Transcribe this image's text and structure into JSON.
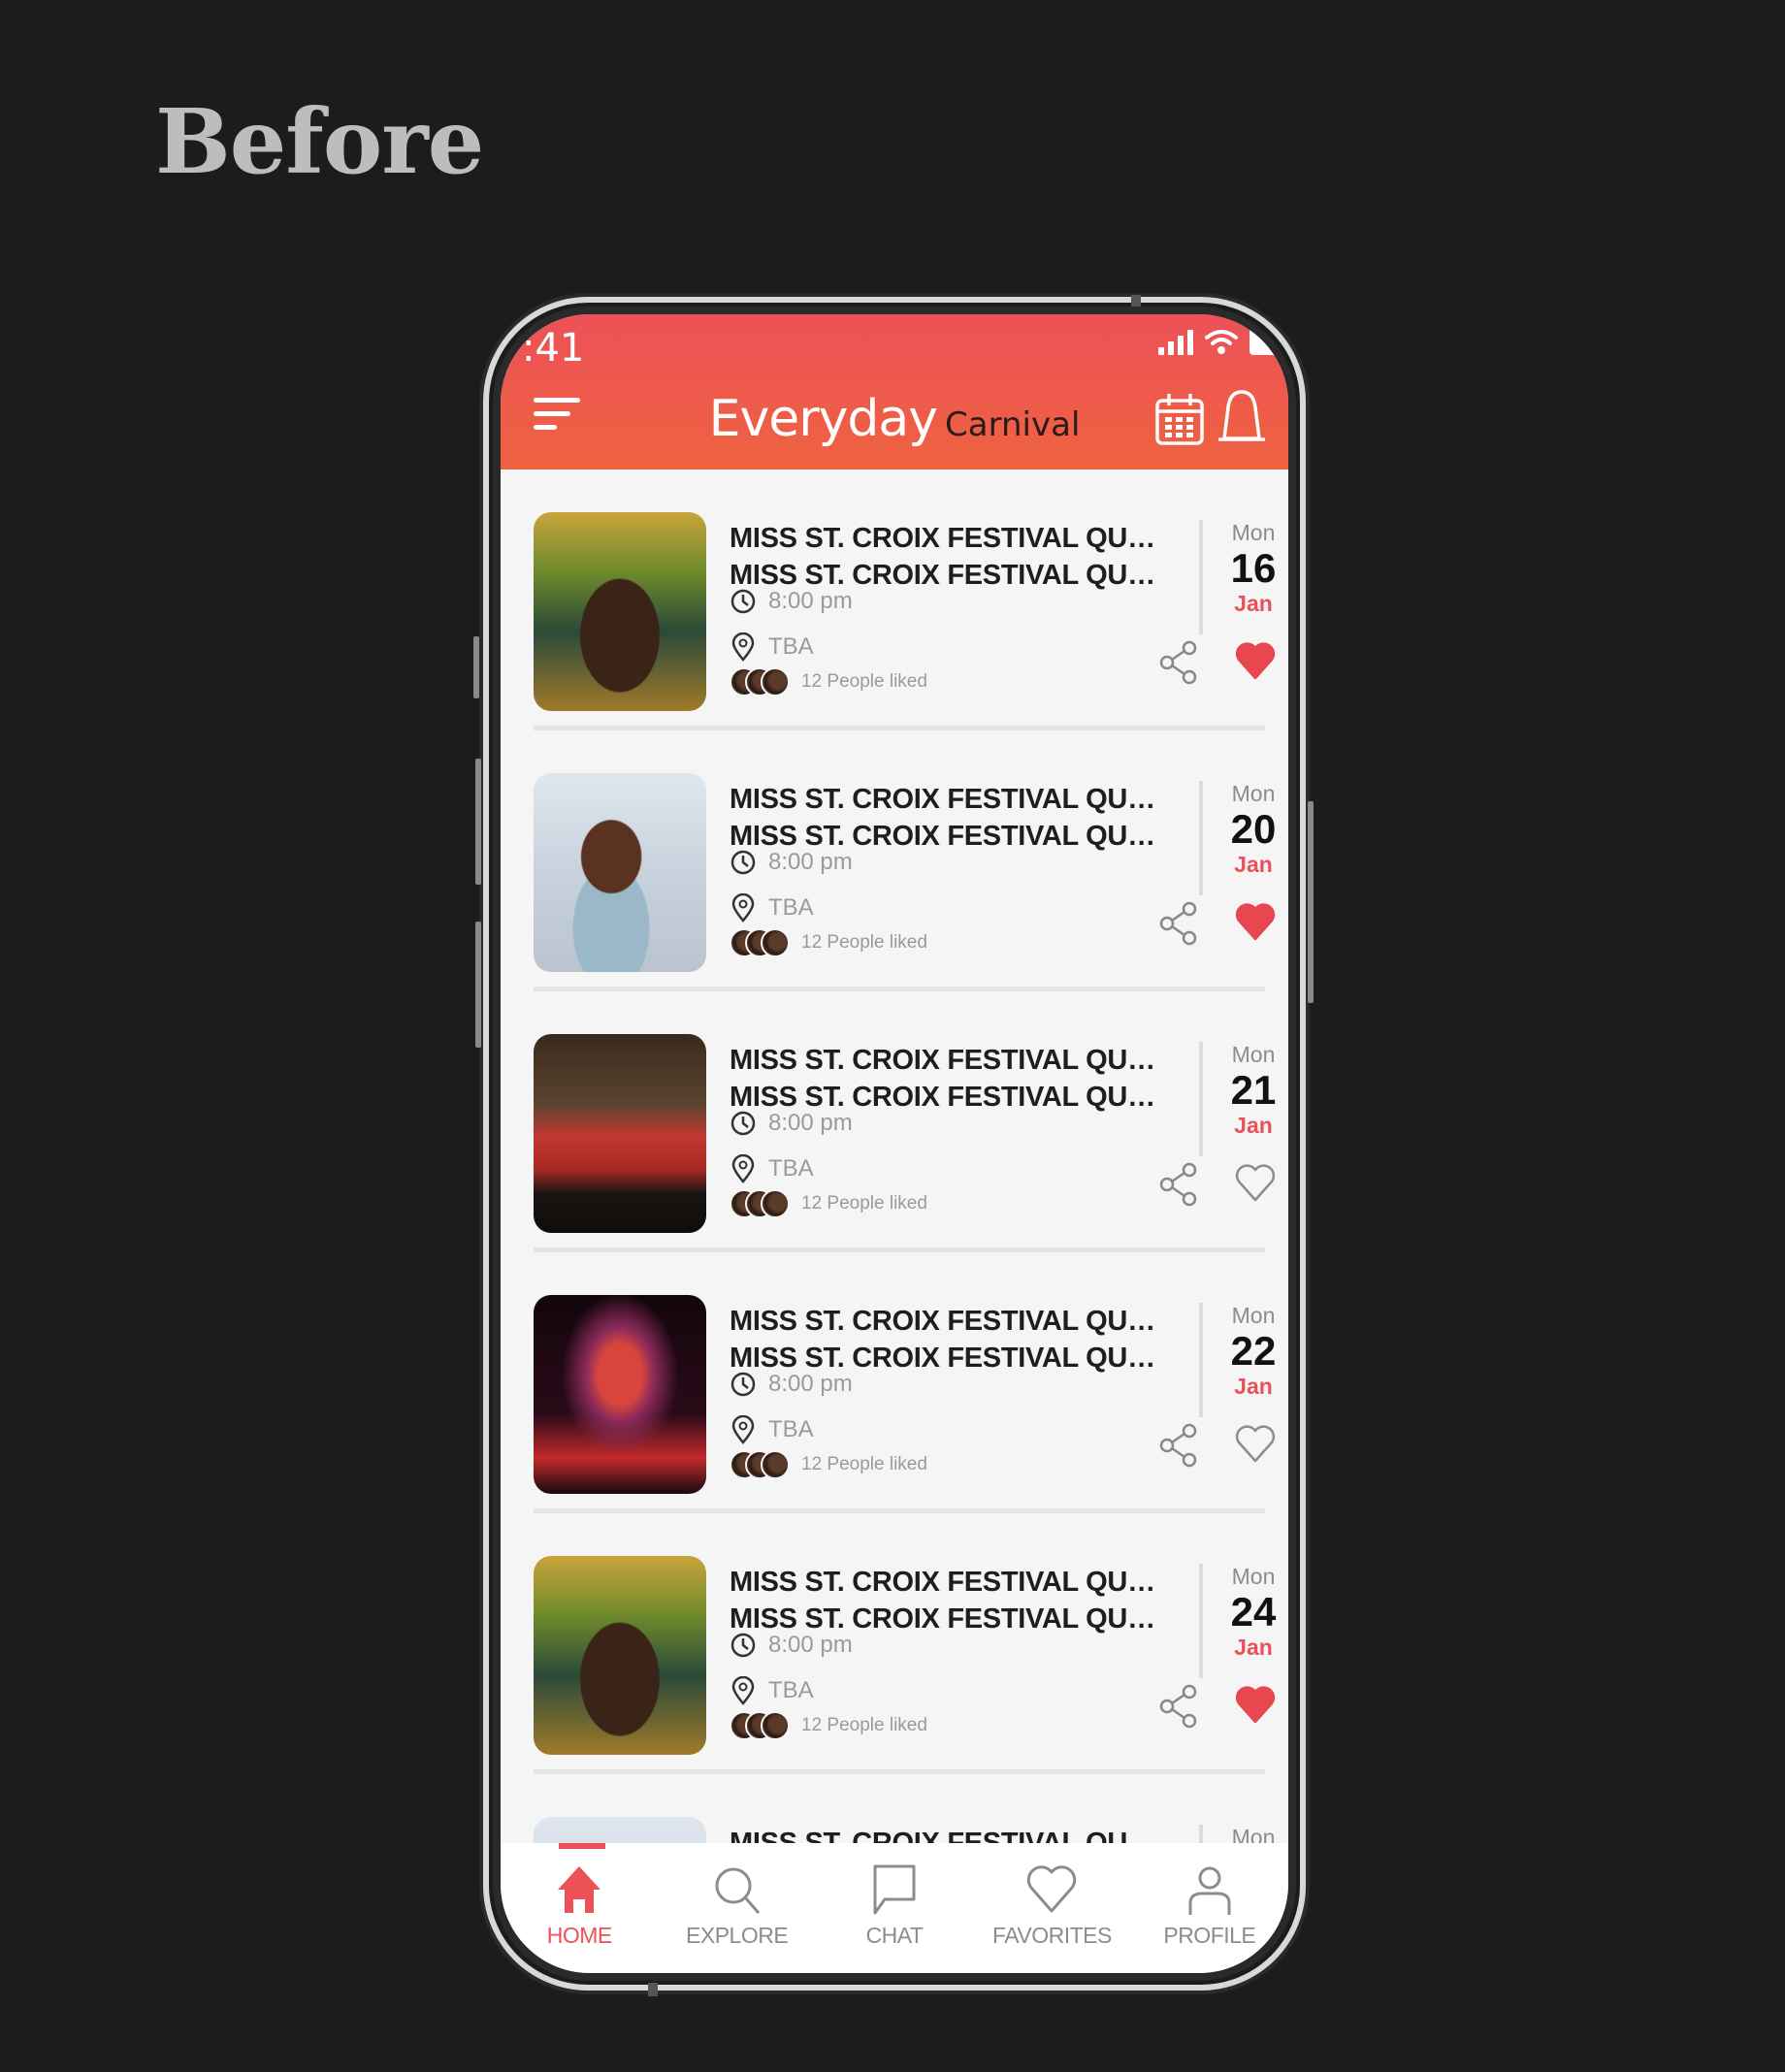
{
  "page_heading": "Before",
  "status_bar": {
    "time": ":41"
  },
  "header": {
    "title_main": "Everyday",
    "title_sub": "Carnival"
  },
  "colors": {
    "accent": "#ec5158",
    "accent_alt": "#ef6340",
    "heart_filled": "#e8474f",
    "icon_gray": "#8c8c8c"
  },
  "events": [
    {
      "title_line1": "MISS ST. CROIX FESTIVAL QUEEN",
      "title_line2": "MISS ST. CROIX FESTIVAL QUEE...",
      "time": "8:00 pm",
      "location": "TBA",
      "likes": "12 People liked",
      "dow": "Mon",
      "day": "16",
      "month": "Jan",
      "favorited": true,
      "image": "carnival-queen-gold-headdress"
    },
    {
      "title_line1": "MISS ST. CROIX FESTIVAL QUEEN",
      "title_line2": "MISS ST. CROIX FESTIVAL QUEE...",
      "time": "8:00 pm",
      "location": "TBA",
      "likes": "12 People liked",
      "dow": "Mon",
      "day": "20",
      "month": "Jan",
      "favorited": true,
      "image": "carnival-queen-white-feathers"
    },
    {
      "title_line1": "MISS ST. CROIX FESTIVAL QUEEN",
      "title_line2": "MISS ST. CROIX FESTIVAL QUEE...",
      "time": "8:00 pm",
      "location": "TBA",
      "likes": "12 People liked",
      "dow": "Mon",
      "day": "21",
      "month": "Jan",
      "favorited": false,
      "image": "choir-in-cathedral"
    },
    {
      "title_line1": "MISS ST. CROIX FESTIVAL QUEEN",
      "title_line2": "MISS ST. CROIX FESTIVAL QUEE...",
      "time": "8:00 pm",
      "location": "TBA",
      "likes": "12 People liked",
      "dow": "Mon",
      "day": "22",
      "month": "Jan",
      "favorited": false,
      "image": "fireworks-over-water"
    },
    {
      "title_line1": "MISS ST. CROIX FESTIVAL QUEEN",
      "title_line2": "MISS ST. CROIX FESTIVAL QUEE...",
      "time": "8:00 pm",
      "location": "TBA",
      "likes": "12 People liked",
      "dow": "Mon",
      "day": "24",
      "month": "Jan",
      "favorited": true,
      "image": "carnival-queen-gold-headdress"
    },
    {
      "title_line1": "MISS ST. CROIX FESTIVAL QUEEN",
      "dow": "Mon",
      "image": "carnival-queen-white-feathers"
    }
  ],
  "bottom_nav": [
    {
      "label": "HOME",
      "icon": "home-icon",
      "active": true
    },
    {
      "label": "EXPLORE",
      "icon": "search-icon",
      "active": false
    },
    {
      "label": "CHAT",
      "icon": "chat-icon",
      "active": false
    },
    {
      "label": "FAVORITES",
      "icon": "heart-icon",
      "active": false
    },
    {
      "label": "PROFILE",
      "icon": "profile-icon",
      "active": false
    }
  ]
}
